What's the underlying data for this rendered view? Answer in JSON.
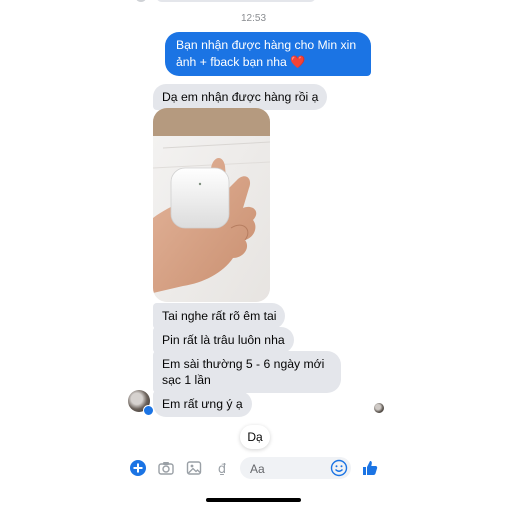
{
  "thread": {
    "timestamp": "12:53",
    "outgoing_message": "Bạn nhận được hàng cho Min xin ảnh + fback bạn nha",
    "outgoing_emoji": "❤️",
    "incoming_messages": [
      "Dạ em nhận được hàng rồi ạ",
      "Tai nghe rất rõ êm tai",
      "Pin rất là trâu luôn nha",
      "Em sài thường 5 - 6 ngày mới sạc 1 lần",
      "Em rất ưng ý ạ"
    ],
    "draft_reply": "Dạ"
  },
  "composer": {
    "placeholder": "Aa",
    "icons": [
      "plus-circle-icon",
      "camera-icon",
      "image-icon",
      "currency-icon",
      "emoji-icon",
      "thumbs-up-icon"
    ]
  },
  "colors": {
    "outgoing_bubble": "#1b74e4",
    "incoming_bubble": "#e4e6eb",
    "accent": "#1b74e4"
  }
}
